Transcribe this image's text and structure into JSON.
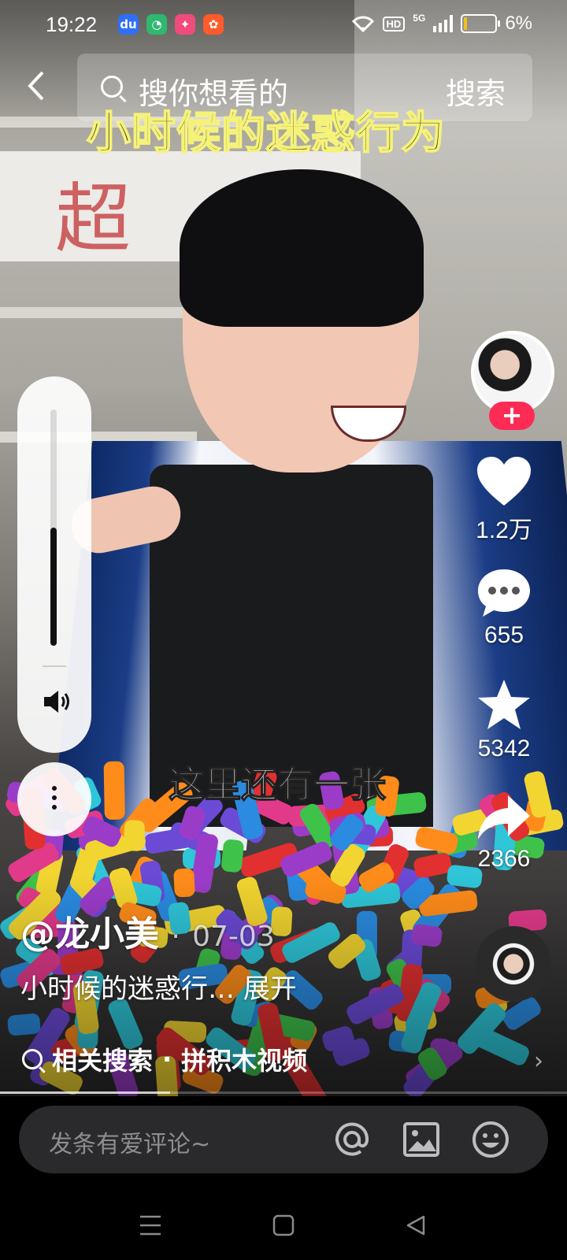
{
  "status_bar": {
    "time": "19:22",
    "battery_text": "6%",
    "hd_label": "HD",
    "network_label": "5G"
  },
  "status_icons": [
    {
      "name": "baidu-app-icon",
      "glyph": "du",
      "color": "#2f6ff5"
    },
    {
      "name": "green-app-icon",
      "glyph": "◔",
      "color": "#2fb86f"
    },
    {
      "name": "pink-app-icon",
      "glyph": "✦",
      "color": "#f04b7b"
    },
    {
      "name": "orange-app-icon",
      "glyph": "✿",
      "color": "#ff5a2a"
    }
  ],
  "search": {
    "placeholder": "搜你想看的",
    "button": "搜索"
  },
  "video": {
    "title_caption": "小时候的迷惑行为",
    "subtitle": "这里还有一张",
    "volume_level": 0.5,
    "progress": 0.3
  },
  "rail": {
    "likes": "1.2万",
    "comments": "655",
    "favorites": "5342",
    "shares": "2366",
    "follow_symbol": "+"
  },
  "post": {
    "author": "@龙小美",
    "separator": "·",
    "date": "07-03",
    "description": "小时候的迷惑行… 展开",
    "related_label": "相关搜索",
    "related_topic": "拼积木视频"
  },
  "comment_bar": {
    "placeholder": "发条有爱评论~"
  },
  "colors": {
    "follow": "#fe2c55",
    "comment_bar_bg": "#2a2a2c"
  }
}
